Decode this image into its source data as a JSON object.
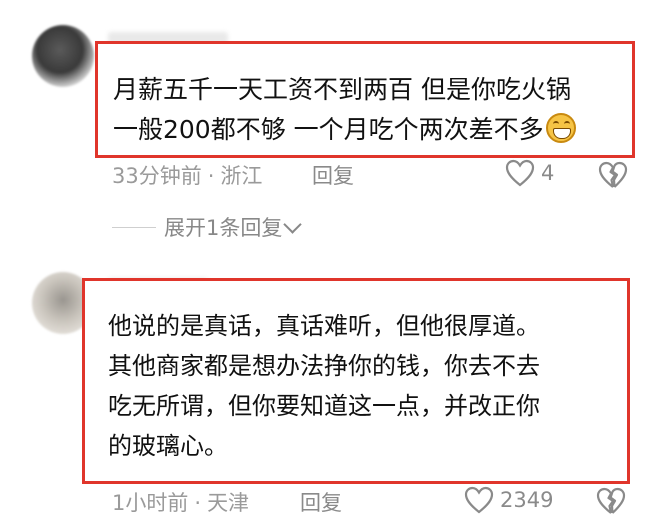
{
  "comments": [
    {
      "text_line1": "月薪五千一天工资不到两百 但是你吃火锅",
      "text_line2": "一般200都不够 一个月吃个两次差不多",
      "emoji": "grinning-face-emoji",
      "time": "33分钟前",
      "location": "浙江",
      "reply_label": "回复",
      "likes": "4"
    },
    {
      "text_lines": [
        "他说的是真话，真话难听，但他很厚道。",
        "其他商家都是想办法挣你的钱，你去不去",
        "吃无所谓，但你要知道这一点，并改正你",
        "的玻璃心。"
      ],
      "time": "1小时前",
      "location": "天津",
      "reply_label": "回复",
      "likes": "2349"
    }
  ],
  "expand_replies": "展开1条回复",
  "separator": "·",
  "colors": {
    "highlight_border": "#e0352b",
    "meta_text": "#9a9a9a"
  }
}
